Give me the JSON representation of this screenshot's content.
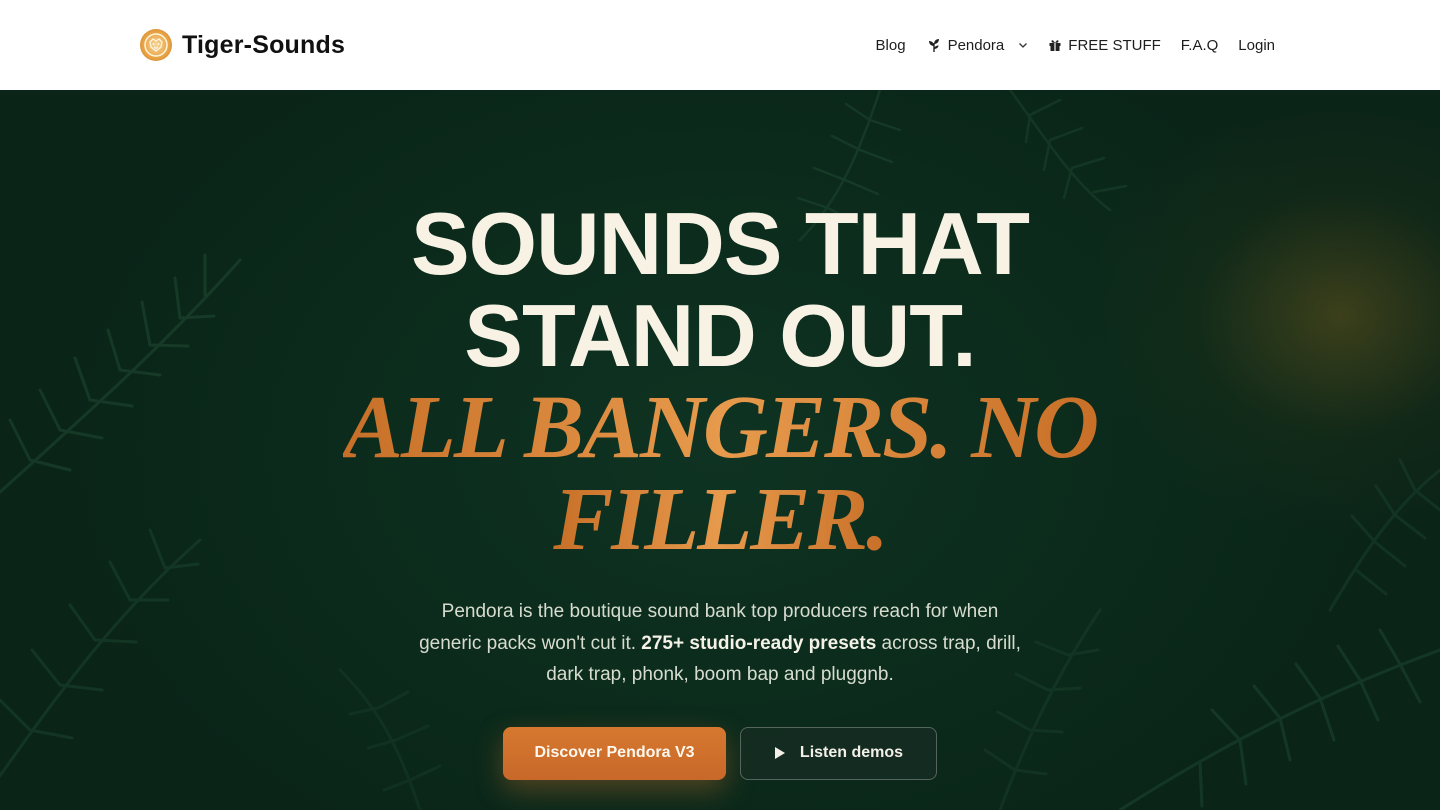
{
  "brand": {
    "name": "Tiger-Sounds",
    "logo_icon": "tiger-logo-icon"
  },
  "nav": {
    "blog": "Blog",
    "pendora": "Pendora",
    "free_stuff": "FREE STUFF",
    "faq": "F.A.Q",
    "login": "Login"
  },
  "hero": {
    "title_line_1": "SOUNDS THAT",
    "title_line_2": "STAND OUT.",
    "accent_line_1": "ALL BANGERS. NO",
    "accent_line_2": "FILLER.",
    "description_pre": "Pendora is the boutique sound bank top producers reach for when generic packs won't cut it. ",
    "description_bold": "275+ studio-ready presets",
    "description_post": " across trap, drill, dark trap, phonk, boom bap and pluggnb.",
    "primary_cta": "Discover Pendora V3",
    "secondary_cta": "Listen demos"
  },
  "colors": {
    "accent": "#D6782F",
    "hero_bg": "#0C2A1C",
    "title": "#F7F2E4"
  }
}
